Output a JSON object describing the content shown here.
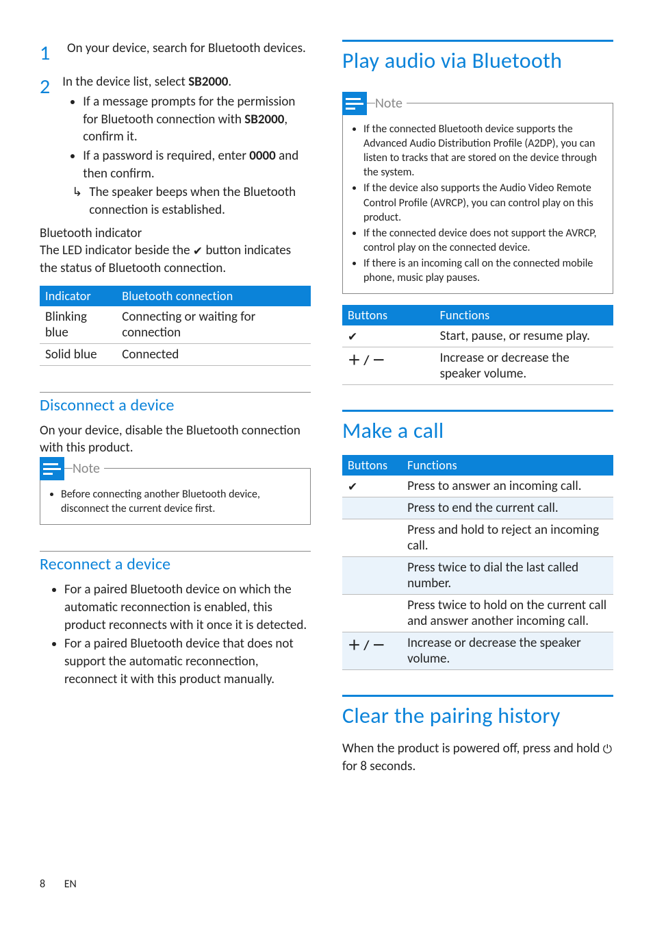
{
  "left": {
    "steps": [
      {
        "num": "1",
        "text": "On your device, search for Bluetooth devices."
      },
      {
        "num": "2",
        "text_pre": "In the device list, select ",
        "text_bold": "SB2000",
        "text_post": ".",
        "subs": [
          {
            "pre": "If a message prompts for the permission for Bluetooth connection with ",
            "b": "SB2000",
            "post": ", confirm it."
          },
          {
            "pre": "If a password is required, enter ",
            "b": "0000",
            "post": " and then confirm."
          }
        ],
        "arrow": "The speaker beeps when the Bluetooth connection is established."
      }
    ],
    "indicator_head": "Bluetooth indicator",
    "indicator_para_pre": "The LED indicator beside the ",
    "indicator_para_post": " button indicates the status of Bluetooth connection.",
    "table_ind": {
      "h1": "Indicator",
      "h2": "Bluetooth connection",
      "rows": [
        {
          "c1": "Blinking blue",
          "c2": "Connecting or waiting for connection"
        },
        {
          "c1": "Solid blue",
          "c2": "Connected"
        }
      ]
    },
    "disconnect_h": "Disconnect a device",
    "disconnect_p": "On your device, disable the Bluetooth connection with this product.",
    "note_label": "Note",
    "note_items": [
      "Before connecting another Bluetooth device, disconnect the current device first."
    ],
    "reconnect_h": "Reconnect a device",
    "reconnect_items": [
      "For a paired Bluetooth device on which the automatic reconnection is enabled, this product reconnects with it once it is detected.",
      "For a paired Bluetooth device that does not support the automatic reconnection, reconnect it with this product manually."
    ]
  },
  "right": {
    "play_h": "Play audio via Bluetooth",
    "note_label": "Note",
    "note_items": [
      "If the connected Bluetooth device supports the Advanced Audio Distribution Profile (A2DP), you can listen to tracks that are stored on the device through the system.",
      "If the device also supports the Audio Video Remote Control Profile (AVRCP), you can control play on this product.",
      "If the connected device does not support the AVRCP, control play on the connected device.",
      "If there is an incoming call on the connected mobile phone, music play pauses."
    ],
    "table_btn": {
      "h1": "Buttons",
      "h2": "Functions",
      "rows": [
        {
          "sym": "phone",
          "c2": "Start, pause, or resume play."
        },
        {
          "sym": "plusminus",
          "c2": "Increase or decrease the speaker volume."
        }
      ]
    },
    "call_h": "Make a call",
    "table_call": {
      "h1": "Buttons",
      "h2": "Functions",
      "rows": [
        {
          "sym": "phone",
          "c2": "Press to answer an incoming call.",
          "shade": false
        },
        {
          "sym": "",
          "c2": "Press to end the current call.",
          "shade": true
        },
        {
          "sym": "",
          "c2": "Press and hold to reject an incoming call.",
          "shade": false
        },
        {
          "sym": "",
          "c2": "Press twice to dial the last called number.",
          "shade": true
        },
        {
          "sym": "",
          "c2": "Press twice to hold on the current call and answer another incoming call.",
          "shade": false
        },
        {
          "sym": "plusminus",
          "c2": "Increase or decrease the speaker volume.",
          "shade": true
        }
      ]
    },
    "clear_h": "Clear the pairing history",
    "clear_p_pre": "When the product is powered off, press and hold ",
    "clear_p_post": " for 8 seconds."
  },
  "footer": {
    "page": "8",
    "lang": "EN"
  }
}
